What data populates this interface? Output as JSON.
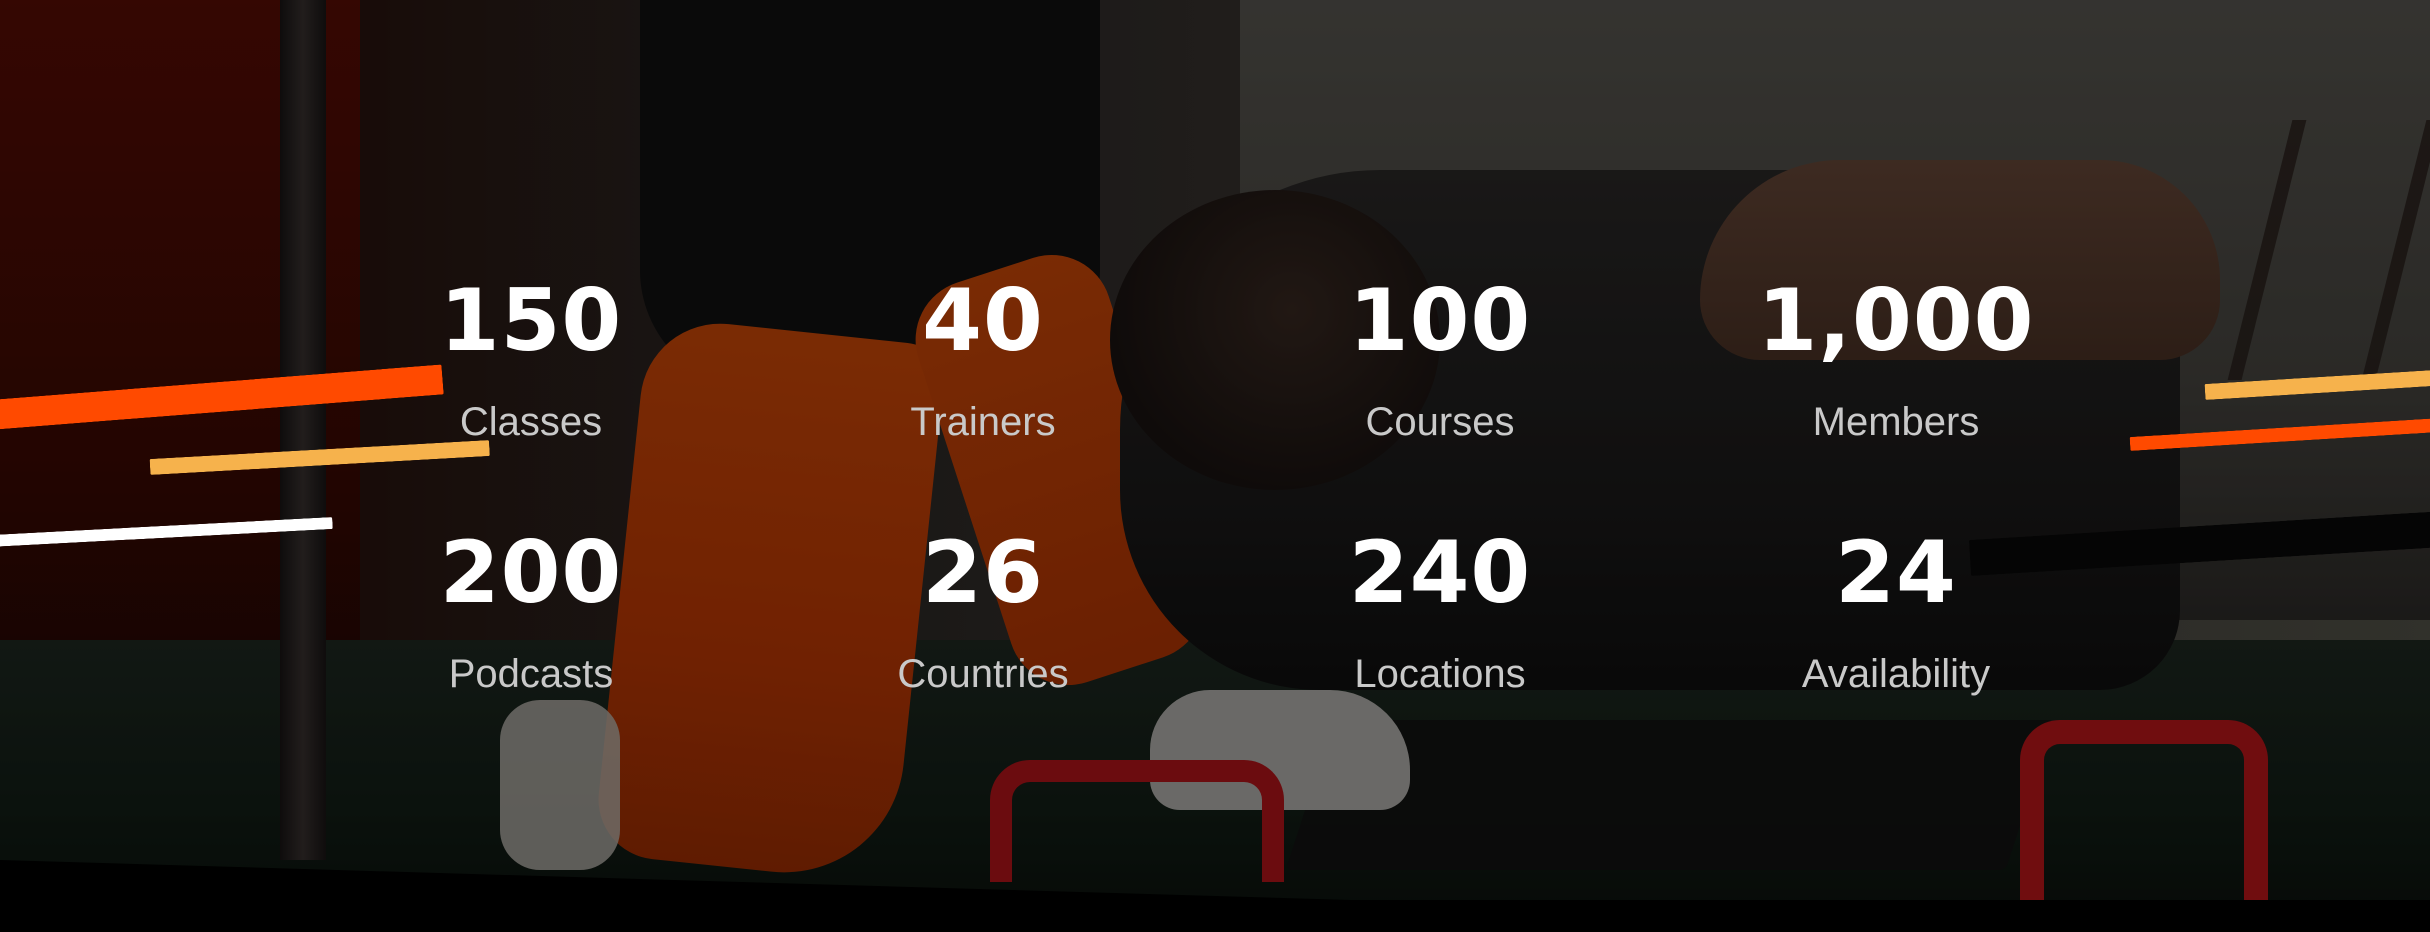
{
  "stats": [
    {
      "value": "150",
      "label": "Classes"
    },
    {
      "value": "40",
      "label": "Trainers"
    },
    {
      "value": "100",
      "label": "Courses"
    },
    {
      "value": "1,000",
      "label": "Members"
    },
    {
      "value": "200",
      "label": "Podcasts"
    },
    {
      "value": "26",
      "label": "Countries"
    },
    {
      "value": "240",
      "label": "Locations"
    },
    {
      "value": "24",
      "label": "Availability"
    }
  ],
  "colors": {
    "accent_orange": "#ff4a00",
    "accent_yellow": "#f6b24c",
    "number_text": "#ffffff",
    "label_text": "#c9c9c9"
  }
}
